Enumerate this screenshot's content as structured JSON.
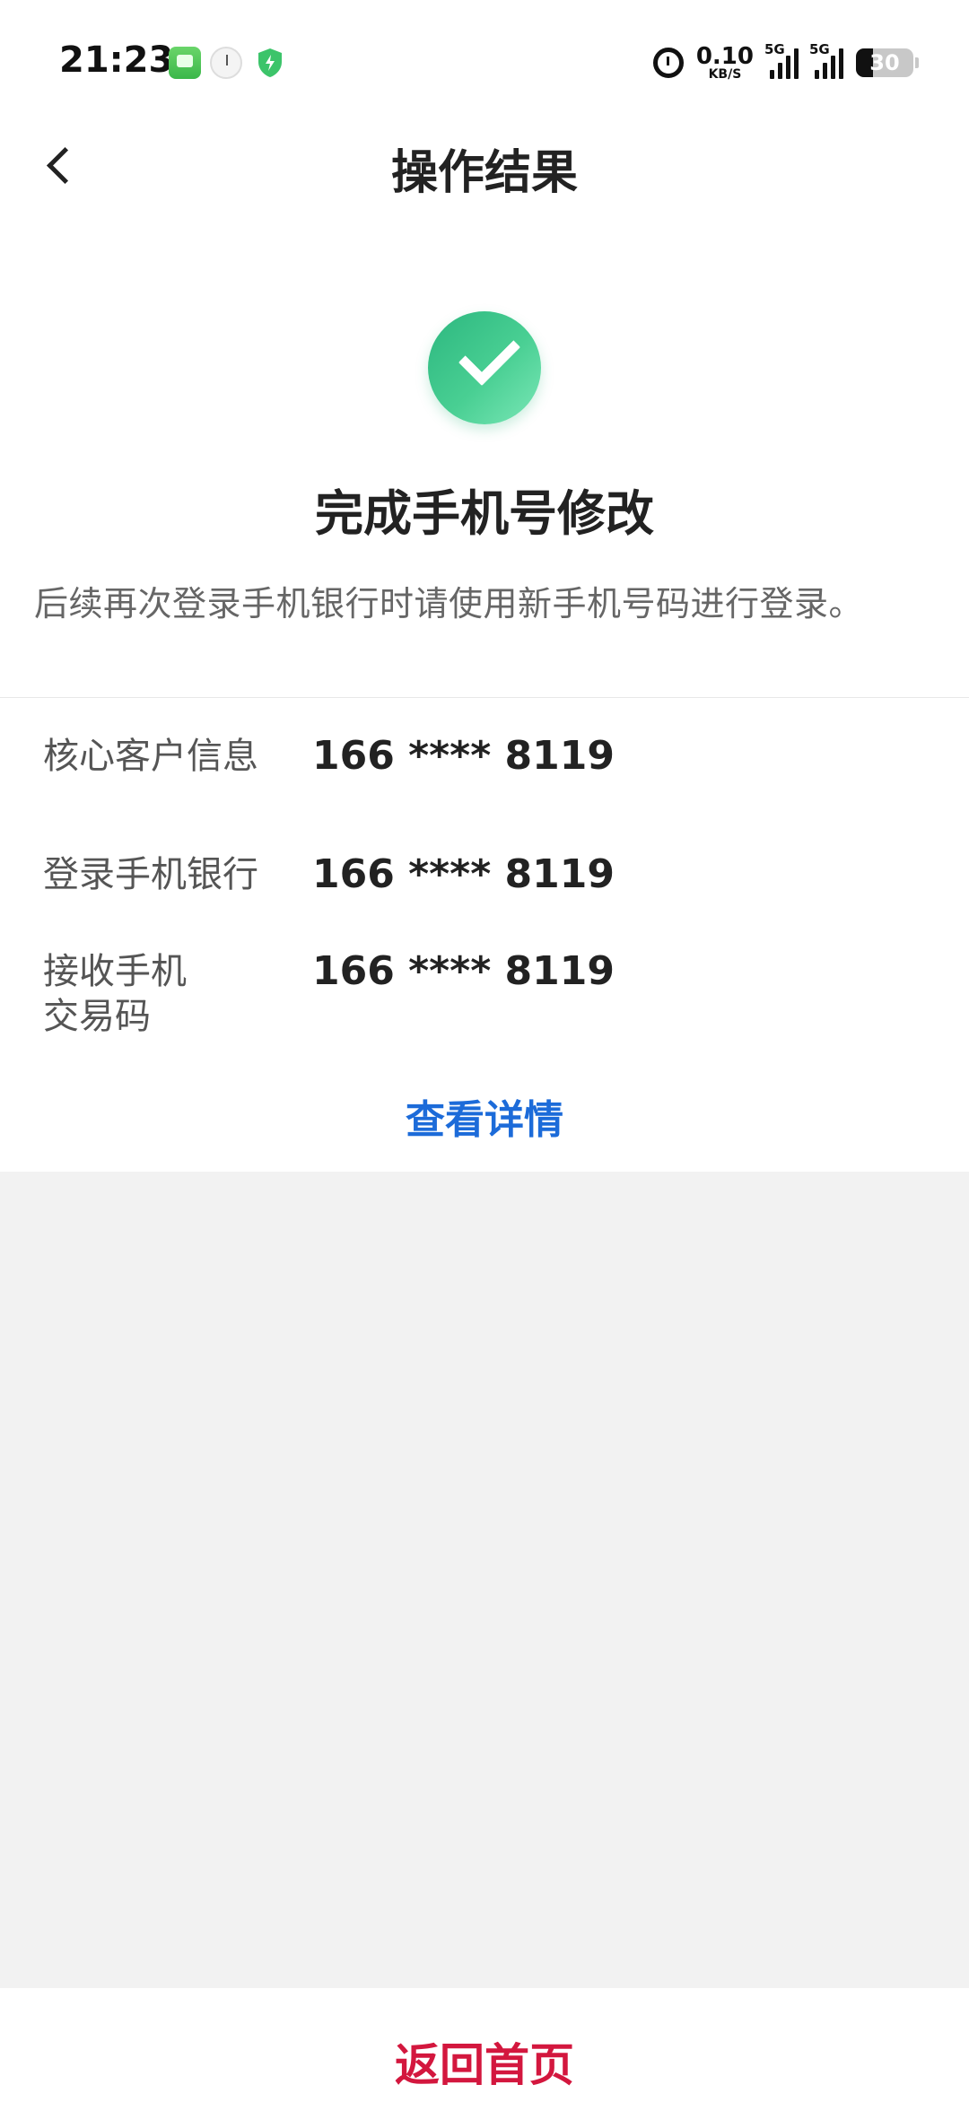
{
  "status_bar": {
    "time": "21:23",
    "net_speed_value": "0.10",
    "net_speed_unit": "KB/S",
    "network_1": "5G",
    "network_2": "5G",
    "battery_level": "30",
    "icons": [
      "message-app-icon",
      "clock-app-icon",
      "security-shield-icon",
      "alarm-icon",
      "signal-icon",
      "battery-icon"
    ]
  },
  "nav": {
    "title": "操作结果",
    "back_icon": "chevron-left-icon"
  },
  "result": {
    "icon": "check-circle-icon",
    "title": "完成手机号修改",
    "description": "后续再次登录手机银行时请使用新手机号码进行登录。"
  },
  "info": [
    {
      "label": "核心客户信息",
      "value": "166 **** 8119"
    },
    {
      "label": "登录手机银行",
      "value": "166 **** 8119"
    },
    {
      "label_line1": "接收手机",
      "label_line2": "交易码",
      "value": "166 **** 8119"
    }
  ],
  "detail_link": "查看详情",
  "home_button": "返回首页",
  "colors": {
    "success_green": "#3cc48a",
    "link_blue": "#1c6bd9",
    "home_red": "#d3173e",
    "page_gray": "#f2f2f2"
  }
}
